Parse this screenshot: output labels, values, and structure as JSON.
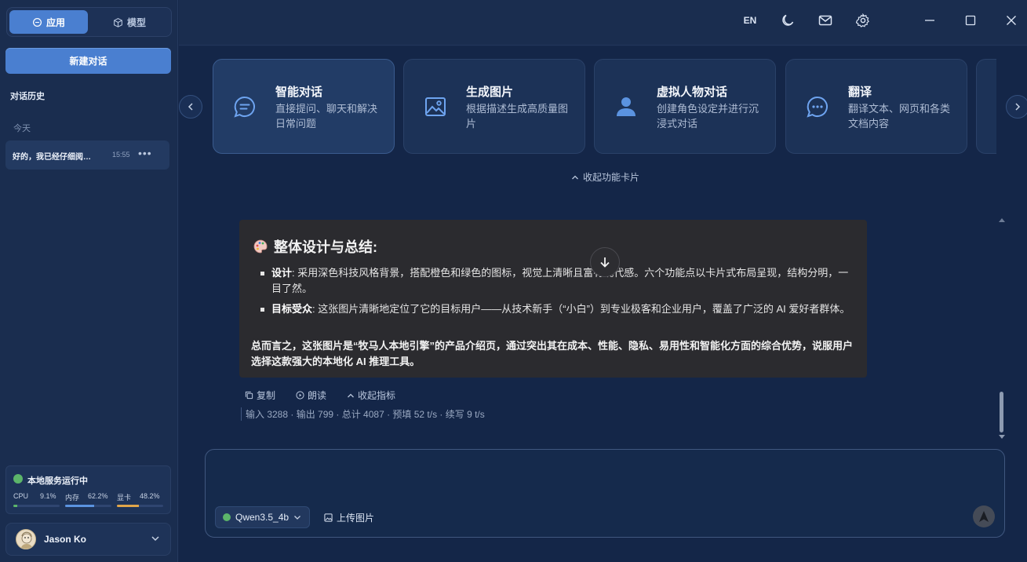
{
  "sidebar": {
    "tabs": [
      {
        "label": "应用",
        "icon": "chat-bubble-icon"
      },
      {
        "label": "模型",
        "icon": "cube-icon"
      }
    ],
    "new_chat_label": "新建对话",
    "history_title": "对话历史",
    "group_today": "今天",
    "conversations": [
      {
        "title": "好的，我已经仔细阅…",
        "time": "15:55"
      }
    ],
    "service": {
      "title": "本地服务运行中",
      "status_color": "#5cb56a",
      "stats": [
        {
          "label": "CPU",
          "value": "9.1%",
          "fraction": 0.091,
          "color": "#5cb56a"
        },
        {
          "label": "内存",
          "value": "62.2%",
          "fraction": 0.622,
          "color": "#5b93e0"
        },
        {
          "label": "显卡",
          "value": "48.2%",
          "fraction": 0.482,
          "color": "#e0a54a"
        }
      ]
    },
    "user": {
      "name": "Jason Ko"
    }
  },
  "topbar": {
    "lang_label": "EN",
    "icons": [
      "moon-icon",
      "mail-icon",
      "gear-icon",
      "minimize-icon",
      "maximize-icon",
      "close-icon"
    ]
  },
  "cards": [
    {
      "title": "智能对话",
      "desc": "直接提问、聊天和解决日常问题",
      "icon": "chat-icon"
    },
    {
      "title": "生成图片",
      "desc": "根据描述生成高质量图片",
      "icon": "image-icon"
    },
    {
      "title": "虚拟人物对话",
      "desc": "创建角色设定并进行沉浸式对话",
      "icon": "person-icon"
    },
    {
      "title": "翻译",
      "desc": "翻译文本、网页和各类文档内容",
      "icon": "translate-chat-icon"
    }
  ],
  "collapse_cards_label": "收起功能卡片",
  "message": {
    "heading": "整体设计与总结:",
    "items": [
      {
        "term": "设计",
        "text": ": 采用深色科技风格背景，搭配橙色和绿色的图标，视觉上清晰且富有现代感。六个功能点以卡片式布局呈现，结构分明，一目了然。"
      },
      {
        "term": "目标受众",
        "text": ": 这张图片清晰地定位了它的目标用户——从技术新手（“小白”）到专业极客和企业用户，覆盖了广泛的 AI 爱好者群体。"
      }
    ],
    "summary": "总而言之，这张图片是“牧马人本地引擎”的产品介绍页，通过突出其在成本、性能、隐私、易用性和智能化方面的综合优势，说服用户选择这款强大的本地化 AI 推理工具。"
  },
  "actions": {
    "copy": "复制",
    "read": "朗读",
    "collapse": "收起指标"
  },
  "stats_line": "输入 3288 · 输出 799 · 总计 4087 · 预填 52 t/s · 续写 9 t/s",
  "composer": {
    "placeholder": "",
    "model": "Qwen3.5_4b",
    "upload_label": "上传图片"
  }
}
